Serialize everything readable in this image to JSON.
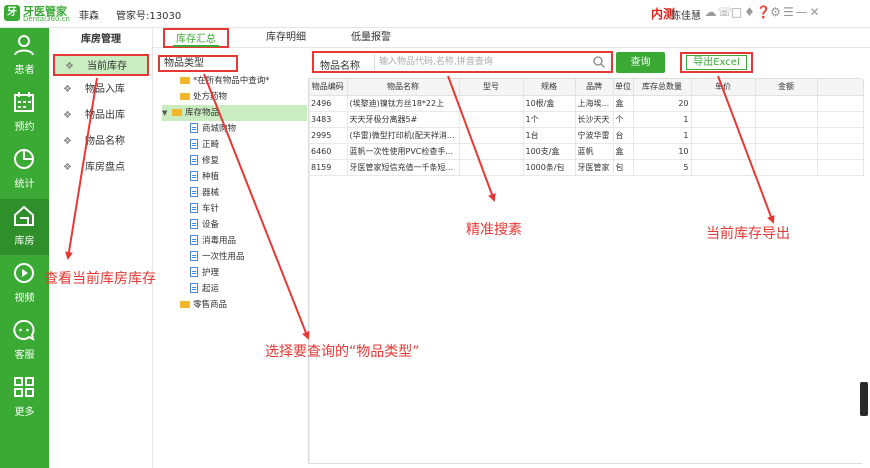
{
  "app": {
    "logo_name": "牙医管家",
    "logo_sub": "Dental360.cn",
    "clinic": "菲森",
    "account": "管家号:13030",
    "beta": "内测",
    "user": "陈佳慧"
  },
  "window_icons": [
    "skin-icon",
    "phone-icon",
    "monitor-icon",
    "bell-icon",
    "help-icon",
    "settings-icon",
    "menu-icon",
    "minimize-icon",
    "close-icon"
  ],
  "leftnav": [
    {
      "label": "患者",
      "icon": "patient-icon"
    },
    {
      "label": "预约",
      "icon": "calendar-icon"
    },
    {
      "label": "统计",
      "icon": "stats-icon"
    },
    {
      "label": "库房",
      "icon": "warehouse-icon",
      "active": true
    },
    {
      "label": "视频",
      "icon": "video-icon"
    },
    {
      "label": "客服",
      "icon": "support-icon"
    },
    {
      "label": "更多",
      "icon": "more-icon"
    }
  ],
  "sidebar": {
    "title": "库房管理",
    "items": [
      {
        "label": "当前库存"
      },
      {
        "label": "物品入库"
      },
      {
        "label": "物品出库"
      },
      {
        "label": "物品名称"
      },
      {
        "label": "库房盘点"
      }
    ]
  },
  "tabs": [
    {
      "label": "库存汇总"
    },
    {
      "label": "库存明细"
    },
    {
      "label": "低量报警"
    }
  ],
  "type_tree": {
    "header": "物品类型",
    "items": [
      {
        "label": "*在所有物品中查询*",
        "kind": "folder"
      },
      {
        "label": "处方药物",
        "kind": "folder"
      },
      {
        "label": "库存物品",
        "kind": "folder"
      },
      {
        "label": "商城购物",
        "kind": "doc"
      },
      {
        "label": "正畸",
        "kind": "doc"
      },
      {
        "label": "修复",
        "kind": "doc"
      },
      {
        "label": "种植",
        "kind": "doc"
      },
      {
        "label": "器械",
        "kind": "doc"
      },
      {
        "label": "车针",
        "kind": "doc"
      },
      {
        "label": "设备",
        "kind": "doc"
      },
      {
        "label": "消毒用品",
        "kind": "doc"
      },
      {
        "label": "一次性用品",
        "kind": "doc"
      },
      {
        "label": "护理",
        "kind": "doc"
      },
      {
        "label": "起运",
        "kind": "doc"
      },
      {
        "label": "零售商品",
        "kind": "folder"
      }
    ]
  },
  "search": {
    "label": "物品名称",
    "placeholder": "输入物品代码,名称,拼音查询",
    "value": "",
    "query_label": "查询",
    "export_label": "导出Excel"
  },
  "table": {
    "columns": [
      "物品编码",
      "物品名称",
      "型号",
      "规格",
      "品牌",
      "单位",
      "库存总数量",
      "单价",
      "金额"
    ],
    "rows": [
      [
        "2496",
        "(埃黎迪)镍钛方丝18*22上",
        "",
        "10根/盒",
        "上海埃...",
        "盒",
        "20",
        "",
        ""
      ],
      [
        "3483",
        "天天牙极分离器5#",
        "",
        "1个",
        "长沙天天",
        "个",
        "1",
        "",
        ""
      ],
      [
        "2995",
        "(华雷)微型打印机(配天祥消...",
        "",
        "1台",
        "宁波华雷",
        "台",
        "1",
        "",
        ""
      ],
      [
        "6460",
        "蓝帆一次性使用PVC检查手...",
        "",
        "100支/盒",
        "蓝帆",
        "盒",
        "10",
        "",
        ""
      ],
      [
        "8159",
        "牙医管家短信充值一千条短...",
        "",
        "1000条/包",
        "牙医管家",
        "包",
        "5",
        "",
        ""
      ]
    ]
  },
  "annotations": {
    "view_stock": "查看当前库房库存",
    "select_type": "选择要查询的“物品类型”",
    "precise_search": "精准搜素",
    "export_stock": "当前库存导出"
  },
  "colors": {
    "brand_green": "#3aaa35",
    "highlight_red": "#e53935",
    "selected_bg": "#c9ecc0"
  }
}
